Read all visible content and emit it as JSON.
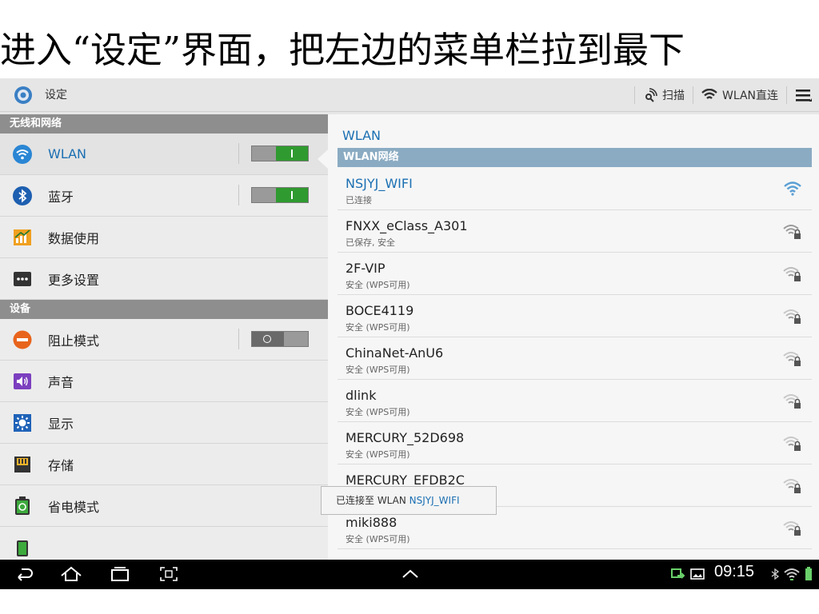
{
  "caption": "进入“设定”界面，把左边的菜单栏拉到最下",
  "actionbar": {
    "title": "设定",
    "scan_label": "扫描",
    "wifi_direct_label": "WLAN直连"
  },
  "sidebar": {
    "sections": [
      {
        "header": "无线和网络",
        "items": [
          {
            "label": "WLAN",
            "icon": "wifi-icon",
            "toggle": "on"
          },
          {
            "label": "蓝牙",
            "icon": "bluetooth-icon",
            "toggle": "on"
          },
          {
            "label": "数据使用",
            "icon": "data-usage-icon"
          },
          {
            "label": "更多设置",
            "icon": "more-icon"
          }
        ]
      },
      {
        "header": "设备",
        "items": [
          {
            "label": "阻止模式",
            "icon": "block-icon",
            "toggle": "off"
          },
          {
            "label": "声音",
            "icon": "sound-icon"
          },
          {
            "label": "显示",
            "icon": "display-icon"
          },
          {
            "label": "存储",
            "icon": "storage-icon"
          },
          {
            "label": "省电模式",
            "icon": "power-saving-icon"
          }
        ]
      }
    ]
  },
  "wlan_panel": {
    "title": "WLAN",
    "section_header": "WLAN网络",
    "networks": [
      {
        "name": "NSJYJ_WIFI",
        "status": "已连接",
        "secured": false
      },
      {
        "name": "FNXX_eClass_A301",
        "status": "已保存, 安全",
        "secured": true
      },
      {
        "name": "2F-VIP",
        "status": "安全 (WPS可用)",
        "secured": true
      },
      {
        "name": "BOCE4119",
        "status": "安全 (WPS可用)",
        "secured": true
      },
      {
        "name": "ChinaNet-AnU6",
        "status": "安全 (WPS可用)",
        "secured": true
      },
      {
        "name": "dlink",
        "status": "安全 (WPS可用)",
        "secured": true
      },
      {
        "name": "MERCURY_52D698",
        "status": "安全 (WPS可用)",
        "secured": true
      },
      {
        "name": "MERCURY_EFDB2C",
        "status": "",
        "secured": true
      },
      {
        "name": "miki888",
        "status": "安全 (WPS可用)",
        "secured": true
      }
    ]
  },
  "toast": {
    "prefix": "已连接至 WLAN ",
    "network": "NSJYJ_WIFI"
  },
  "statusbar": {
    "time": "09:15"
  },
  "colors": {
    "accent": "#1b6fb2",
    "toggle_on": "#2f9a2f",
    "section_header": "#8e8e8e",
    "wlan_header": "#8aabc2"
  }
}
